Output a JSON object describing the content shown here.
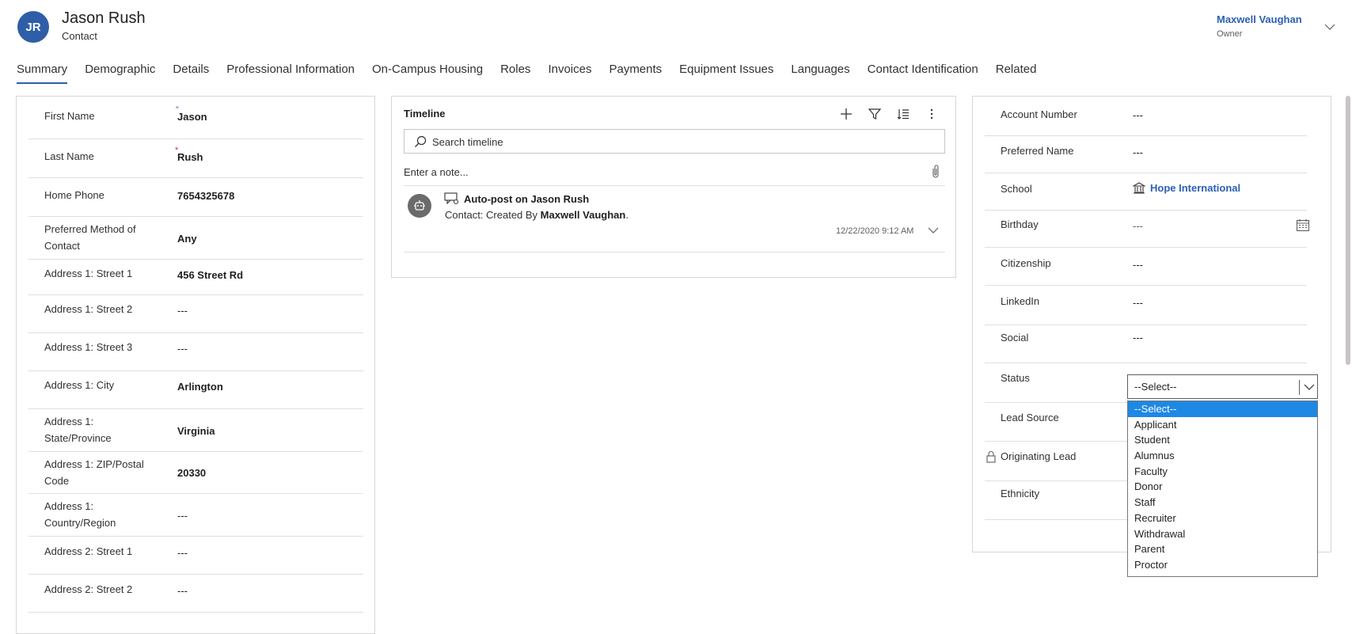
{
  "record": {
    "initials": "JR",
    "name": "Jason Rush",
    "type": "Contact"
  },
  "owner": {
    "name": "Maxwell Vaughan",
    "label": "Owner"
  },
  "tabs": [
    "Summary",
    "Demographic",
    "Details",
    "Professional Information",
    "On-Campus Housing",
    "Roles",
    "Invoices",
    "Payments",
    "Equipment Issues",
    "Languages",
    "Contact Identification",
    "Related"
  ],
  "left_fields": [
    {
      "label": "First Name",
      "value": "Jason",
      "req": "recommended"
    },
    {
      "label": "Last Name",
      "value": "Rush",
      "req": "required"
    },
    {
      "label": "Home Phone",
      "value": "7654325678"
    },
    {
      "label": "Preferred Method of Contact",
      "value": "Any"
    },
    {
      "label": "Address 1: Street 1",
      "value": "456 Street Rd"
    },
    {
      "label": "Address 1: Street 2",
      "value": "---"
    },
    {
      "label": "Address 1: Street 3",
      "value": "---"
    },
    {
      "label": "Address 1: City",
      "value": "Arlington"
    },
    {
      "label": "Address 1: State/Province",
      "value": "Virginia"
    },
    {
      "label": "Address 1: ZIP/Postal Code",
      "value": "20330"
    },
    {
      "label": "Address 1: Country/Region",
      "value": "---"
    },
    {
      "label": "Address 2: Street 1",
      "value": "---"
    },
    {
      "label": "Address 2: Street 2",
      "value": "---"
    }
  ],
  "timeline": {
    "title": "Timeline",
    "search_placeholder": "Search timeline",
    "note_placeholder": "Enter a note...",
    "post": {
      "title": "Auto-post on Jason Rush",
      "body_prefix": "Contact: Created By ",
      "body_author": "Maxwell Vaughan",
      "body_suffix": ".",
      "date": "12/22/2020 9:12 AM"
    }
  },
  "right_fields": {
    "account_number": {
      "label": "Account Number",
      "value": "---"
    },
    "preferred_name": {
      "label": "Preferred Name",
      "value": "---"
    },
    "school": {
      "label": "School",
      "value": "Hope International"
    },
    "birthday": {
      "label": "Birthday",
      "value": "---"
    },
    "citizenship": {
      "label": "Citizenship",
      "value": "---"
    },
    "linkedin": {
      "label": "LinkedIn",
      "value": "---"
    },
    "social": {
      "label": "Social",
      "value": "---"
    },
    "status": {
      "label": "Status",
      "value": "--Select--"
    },
    "lead_source": {
      "label": "Lead Source"
    },
    "originating_lead": {
      "label": "Originating Lead"
    },
    "ethnicity": {
      "label": "Ethnicity"
    }
  },
  "status_options": [
    "--Select--",
    "Applicant",
    "Student",
    "Alumnus",
    "Faculty",
    "Donor",
    "Staff",
    "Recruiter",
    "Withdrawal",
    "Parent",
    "Proctor"
  ],
  "colors": {
    "accent": "#2f5ea8",
    "link": "#2b5fb4",
    "required": "#d13438",
    "dropdown_selected": "#1e88e5"
  }
}
